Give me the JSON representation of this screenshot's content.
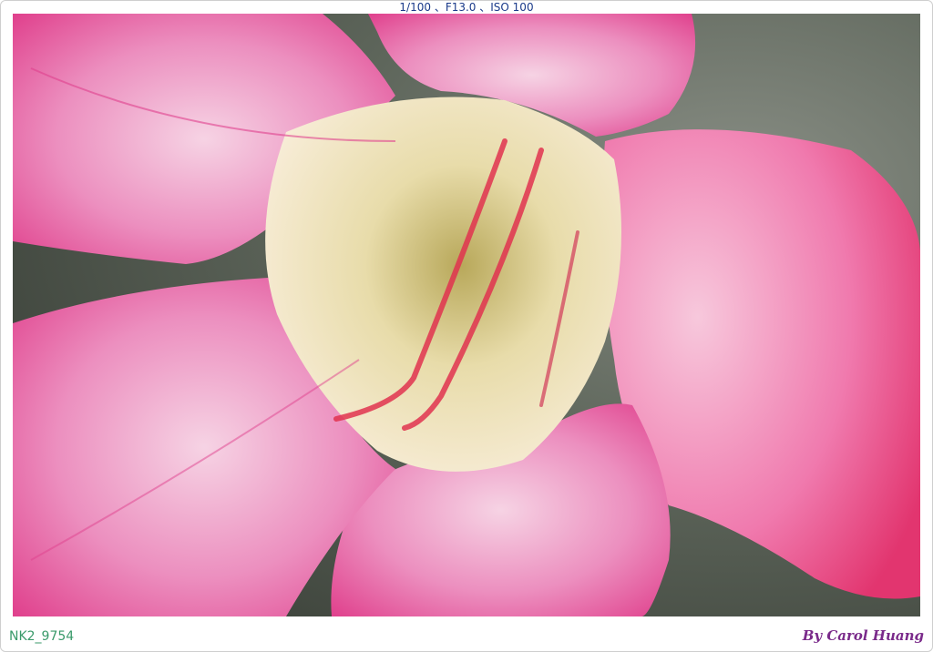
{
  "exif": "1/100 、F13.0 、ISO 100",
  "filename": "NK2_9754",
  "credit": "By Carol Huang",
  "photo": {
    "subject": "pink-desert-rose-flower-macro",
    "colors": {
      "petal": "#e86aa6",
      "petal_light": "#f3c2dc",
      "throat": "#efe3b6",
      "throat_deep": "#c9b66a",
      "vein": "#e0324f",
      "background": "#6d7468"
    }
  }
}
